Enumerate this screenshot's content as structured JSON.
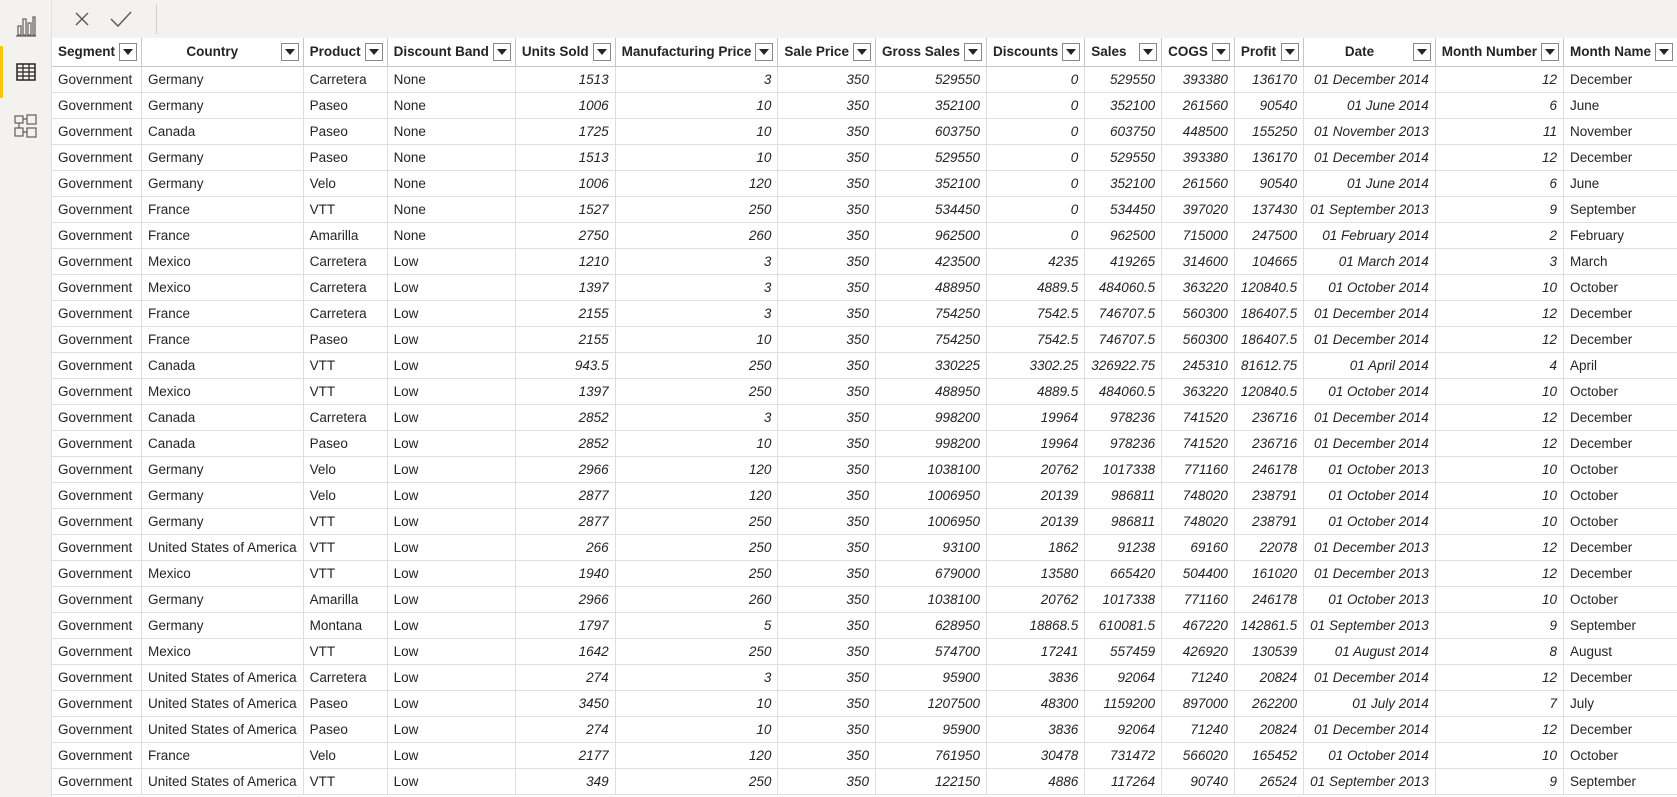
{
  "colors": {
    "accent": "#f2c811",
    "grid_border": "#e1dfdd",
    "text": "#252423"
  },
  "rail": [
    {
      "name": "report-view-icon",
      "active": false
    },
    {
      "name": "data-view-icon",
      "active": true
    },
    {
      "name": "model-view-icon",
      "active": false
    }
  ],
  "formula_bar": {
    "cancel_icon": "close-icon",
    "commit_icon": "check-icon"
  },
  "table": {
    "columns": [
      {
        "label": "Segment",
        "width": 90,
        "num": false,
        "center": false
      },
      {
        "label": "Country",
        "width": 162,
        "num": false,
        "center": true
      },
      {
        "label": "Product",
        "width": 88,
        "num": false,
        "center": false
      },
      {
        "label": "Discount Band",
        "width": 129,
        "num": false,
        "center": false
      },
      {
        "label": "Units Sold",
        "width": 101,
        "num": true,
        "center": false
      },
      {
        "label": "Manufacturing Price",
        "width": 165,
        "num": true,
        "center": false
      },
      {
        "label": "Sale Price",
        "width": 99,
        "num": true,
        "center": false
      },
      {
        "label": "Gross Sales",
        "width": 109,
        "num": true,
        "center": false
      },
      {
        "label": "Discounts",
        "width": 105,
        "num": true,
        "center": false
      },
      {
        "label": "Sales",
        "width": 75,
        "num": true,
        "center": false
      },
      {
        "label": "COGS",
        "width": 76,
        "num": true,
        "center": false
      },
      {
        "label": "Profit",
        "width": 76,
        "num": true,
        "center": false
      },
      {
        "label": "Date",
        "width": 130,
        "num": true,
        "center": true
      },
      {
        "label": "Month Number",
        "width": 136,
        "num": true,
        "center": false
      },
      {
        "label": "Month Name",
        "width": 90,
        "num": false,
        "center": false
      }
    ],
    "rows": [
      [
        "Government",
        "Germany",
        "Carretera",
        "None",
        "1513",
        "3",
        "350",
        "529550",
        "0",
        "529550",
        "393380",
        "136170",
        "01 December 2014",
        "12",
        "December"
      ],
      [
        "Government",
        "Germany",
        "Paseo",
        "None",
        "1006",
        "10",
        "350",
        "352100",
        "0",
        "352100",
        "261560",
        "90540",
        "01 June 2014",
        "6",
        "June"
      ],
      [
        "Government",
        "Canada",
        "Paseo",
        "None",
        "1725",
        "10",
        "350",
        "603750",
        "0",
        "603750",
        "448500",
        "155250",
        "01 November 2013",
        "11",
        "November"
      ],
      [
        "Government",
        "Germany",
        "Paseo",
        "None",
        "1513",
        "10",
        "350",
        "529550",
        "0",
        "529550",
        "393380",
        "136170",
        "01 December 2014",
        "12",
        "December"
      ],
      [
        "Government",
        "Germany",
        "Velo",
        "None",
        "1006",
        "120",
        "350",
        "352100",
        "0",
        "352100",
        "261560",
        "90540",
        "01 June 2014",
        "6",
        "June"
      ],
      [
        "Government",
        "France",
        "VTT",
        "None",
        "1527",
        "250",
        "350",
        "534450",
        "0",
        "534450",
        "397020",
        "137430",
        "01 September 2013",
        "9",
        "September"
      ],
      [
        "Government",
        "France",
        "Amarilla",
        "None",
        "2750",
        "260",
        "350",
        "962500",
        "0",
        "962500",
        "715000",
        "247500",
        "01 February 2014",
        "2",
        "February"
      ],
      [
        "Government",
        "Mexico",
        "Carretera",
        "Low",
        "1210",
        "3",
        "350",
        "423500",
        "4235",
        "419265",
        "314600",
        "104665",
        "01 March 2014",
        "3",
        "March"
      ],
      [
        "Government",
        "Mexico",
        "Carretera",
        "Low",
        "1397",
        "3",
        "350",
        "488950",
        "4889.5",
        "484060.5",
        "363220",
        "120840.5",
        "01 October 2014",
        "10",
        "October"
      ],
      [
        "Government",
        "France",
        "Carretera",
        "Low",
        "2155",
        "3",
        "350",
        "754250",
        "7542.5",
        "746707.5",
        "560300",
        "186407.5",
        "01 December 2014",
        "12",
        "December"
      ],
      [
        "Government",
        "France",
        "Paseo",
        "Low",
        "2155",
        "10",
        "350",
        "754250",
        "7542.5",
        "746707.5",
        "560300",
        "186407.5",
        "01 December 2014",
        "12",
        "December"
      ],
      [
        "Government",
        "Canada",
        "VTT",
        "Low",
        "943.5",
        "250",
        "350",
        "330225",
        "3302.25",
        "326922.75",
        "245310",
        "81612.75",
        "01 April 2014",
        "4",
        "April"
      ],
      [
        "Government",
        "Mexico",
        "VTT",
        "Low",
        "1397",
        "250",
        "350",
        "488950",
        "4889.5",
        "484060.5",
        "363220",
        "120840.5",
        "01 October 2014",
        "10",
        "October"
      ],
      [
        "Government",
        "Canada",
        "Carretera",
        "Low",
        "2852",
        "3",
        "350",
        "998200",
        "19964",
        "978236",
        "741520",
        "236716",
        "01 December 2014",
        "12",
        "December"
      ],
      [
        "Government",
        "Canada",
        "Paseo",
        "Low",
        "2852",
        "10",
        "350",
        "998200",
        "19964",
        "978236",
        "741520",
        "236716",
        "01 December 2014",
        "12",
        "December"
      ],
      [
        "Government",
        "Germany",
        "Velo",
        "Low",
        "2966",
        "120",
        "350",
        "1038100",
        "20762",
        "1017338",
        "771160",
        "246178",
        "01 October 2013",
        "10",
        "October"
      ],
      [
        "Government",
        "Germany",
        "Velo",
        "Low",
        "2877",
        "120",
        "350",
        "1006950",
        "20139",
        "986811",
        "748020",
        "238791",
        "01 October 2014",
        "10",
        "October"
      ],
      [
        "Government",
        "Germany",
        "VTT",
        "Low",
        "2877",
        "250",
        "350",
        "1006950",
        "20139",
        "986811",
        "748020",
        "238791",
        "01 October 2014",
        "10",
        "October"
      ],
      [
        "Government",
        "United States of America",
        "VTT",
        "Low",
        "266",
        "250",
        "350",
        "93100",
        "1862",
        "91238",
        "69160",
        "22078",
        "01 December 2013",
        "12",
        "December"
      ],
      [
        "Government",
        "Mexico",
        "VTT",
        "Low",
        "1940",
        "250",
        "350",
        "679000",
        "13580",
        "665420",
        "504400",
        "161020",
        "01 December 2013",
        "12",
        "December"
      ],
      [
        "Government",
        "Germany",
        "Amarilla",
        "Low",
        "2966",
        "260",
        "350",
        "1038100",
        "20762",
        "1017338",
        "771160",
        "246178",
        "01 October 2013",
        "10",
        "October"
      ],
      [
        "Government",
        "Germany",
        "Montana",
        "Low",
        "1797",
        "5",
        "350",
        "628950",
        "18868.5",
        "610081.5",
        "467220",
        "142861.5",
        "01 September 2013",
        "9",
        "September"
      ],
      [
        "Government",
        "Mexico",
        "VTT",
        "Low",
        "1642",
        "250",
        "350",
        "574700",
        "17241",
        "557459",
        "426920",
        "130539",
        "01 August 2014",
        "8",
        "August"
      ],
      [
        "Government",
        "United States of America",
        "Carretera",
        "Low",
        "274",
        "3",
        "350",
        "95900",
        "3836",
        "92064",
        "71240",
        "20824",
        "01 December 2014",
        "12",
        "December"
      ],
      [
        "Government",
        "United States of America",
        "Paseo",
        "Low",
        "3450",
        "10",
        "350",
        "1207500",
        "48300",
        "1159200",
        "897000",
        "262200",
        "01 July 2014",
        "7",
        "July"
      ],
      [
        "Government",
        "United States of America",
        "Paseo",
        "Low",
        "274",
        "10",
        "350",
        "95900",
        "3836",
        "92064",
        "71240",
        "20824",
        "01 December 2014",
        "12",
        "December"
      ],
      [
        "Government",
        "France",
        "Velo",
        "Low",
        "2177",
        "120",
        "350",
        "761950",
        "30478",
        "731472",
        "566020",
        "165452",
        "01 October 2014",
        "10",
        "October"
      ],
      [
        "Government",
        "United States of America",
        "VTT",
        "Low",
        "349",
        "250",
        "350",
        "122150",
        "4886",
        "117264",
        "90740",
        "26524",
        "01 September 2013",
        "9",
        "September"
      ]
    ]
  }
}
